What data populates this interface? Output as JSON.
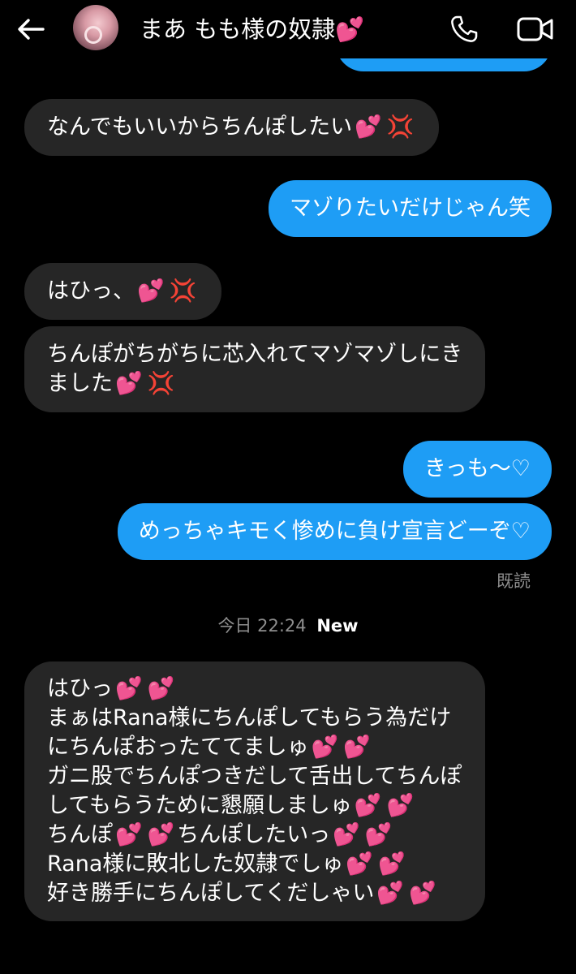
{
  "header": {
    "contact_name": "まあ もも様の奴隷",
    "name_emoji": "💕"
  },
  "icons": {
    "back": "back-arrow-icon",
    "call": "phone-icon",
    "video": "video-camera-icon"
  },
  "colors": {
    "background": "#000000",
    "received_bubble": "#262626",
    "sent_bubble": "#1e9df5",
    "meta_text": "#8e8e8e"
  },
  "messages": [
    {
      "direction": "received",
      "text": "なんでもいいからちんぽしたい",
      "emoji": [
        "💕",
        "💢"
      ]
    },
    {
      "direction": "sent",
      "text": "マゾりたいだけじゃん笑"
    },
    {
      "direction": "received",
      "text": "はひっ、",
      "emoji": [
        "💕",
        "💢"
      ]
    },
    {
      "direction": "received",
      "lines": [
        "ちんぽがちがちに芯入れてマゾマゾしにき",
        "ました"
      ],
      "emoji": [
        "💕",
        "💢"
      ]
    },
    {
      "direction": "sent",
      "text": "きっも〜♡"
    },
    {
      "direction": "sent",
      "text": "めっちゃキモく惨めに負け宣言どーぞ♡"
    }
  ],
  "read_receipt": "既読",
  "divider": {
    "date_label": "今日",
    "time": "22:24",
    "new_label": "New"
  },
  "last_message": {
    "direction": "received",
    "lines": [
      "はひっ",
      "まぁはRana様にちんぽしてもらう為だけ",
      "にちんぽおったててましゅ",
      "ガニ股でちんぽつきだして舌出してちんぽ",
      "してもらうために懇願しましゅ",
      "ちんぽ",
      "ちんぽしたいっ",
      "Rana様に敗北した奴隷でしゅ",
      "好き勝手にちんぽしてくだしゃい"
    ],
    "heart": "💕"
  }
}
